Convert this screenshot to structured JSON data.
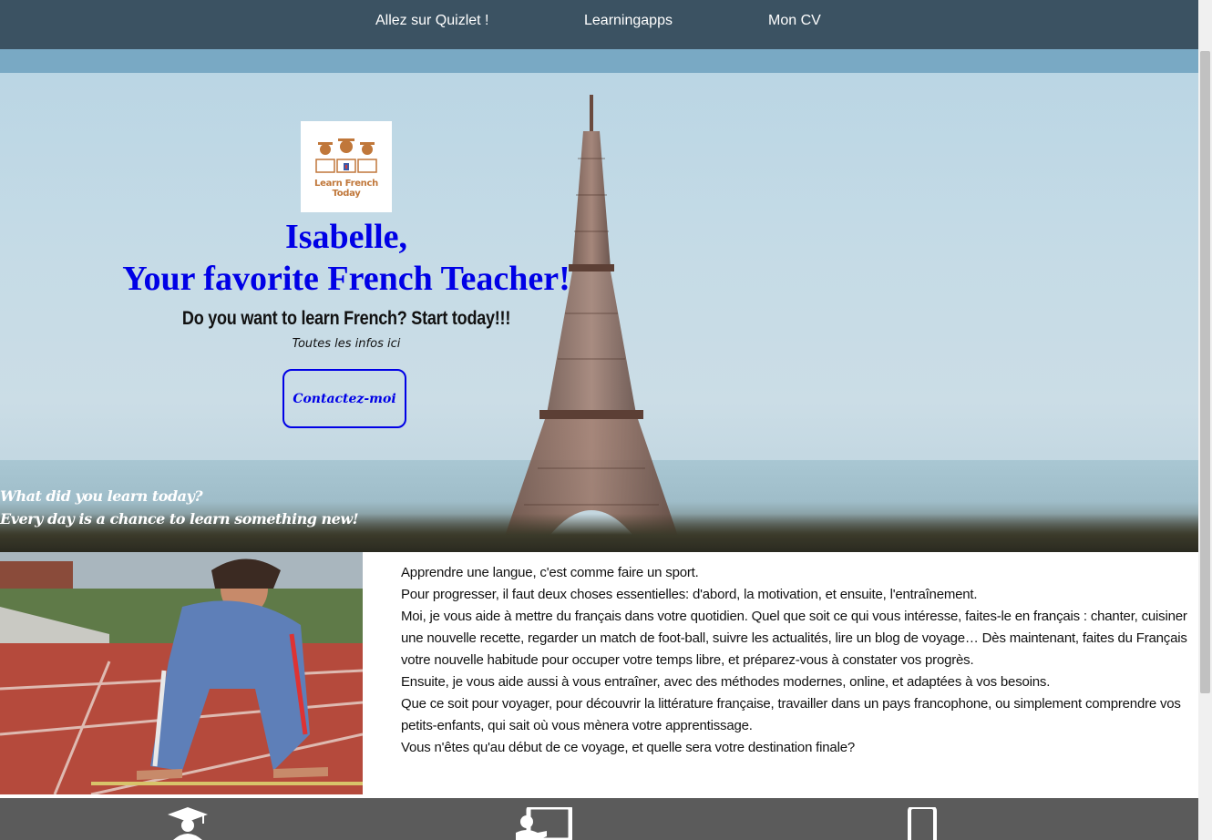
{
  "nav": {
    "items": [
      {
        "label": "Allez sur Quizlet !"
      },
      {
        "label": "Learningapps"
      },
      {
        "label": "Mon CV"
      }
    ]
  },
  "hero": {
    "logo_text": "Learn French Today",
    "name_line": "Isabelle,",
    "title_line": "Your favorite French Teacher!",
    "cta_heading": "Do you want to learn French? Start today!!!",
    "info_text": "Toutes les infos ici",
    "contact_button": "Contactez-moi",
    "tagline_1": "What did you learn today?",
    "tagline_2": "Every day is a chance to learn something new!"
  },
  "content": {
    "paragraphs": [
      "Apprendre une langue, c'est comme faire un sport.",
      "Pour progresser, il faut deux choses essentielles: d'abord, la motivation, et ensuite, l'entraînement.",
      "Moi, je vous aide à mettre du français dans votre quotidien. Quel que soit ce qui vous intéresse, faites-le en français : chanter, cuisiner une nouvelle recette, regarder un match de foot-ball, suivre les actualités, lire un blog de voyage… Dès maintenant, faites du Français votre nouvelle habitude pour occuper votre temps libre, et préparez-vous à constater vos progrès.",
      "Ensuite, je vous aide aussi à vous entraîner, avec des méthodes modernes, online, et adaptées à vos besoins.",
      "Que ce soit pour voyager, pour découvrir la littérature française, travailler dans un pays francophone, ou simplement comprendre vos petits-enfants, qui sait où vous mènera votre apprentissage.",
      "Vous n'êtes qu'au début de ce voyage, et quelle sera votre destination finale?"
    ]
  },
  "footer": {
    "icons": [
      "graduate-icon",
      "teacher-board-icon",
      "mobile-phone-icon"
    ]
  },
  "colors": {
    "nav_bg": "#3b5262",
    "heading_blue": "#0000e6",
    "footer_bg": "#5b5b5b"
  }
}
